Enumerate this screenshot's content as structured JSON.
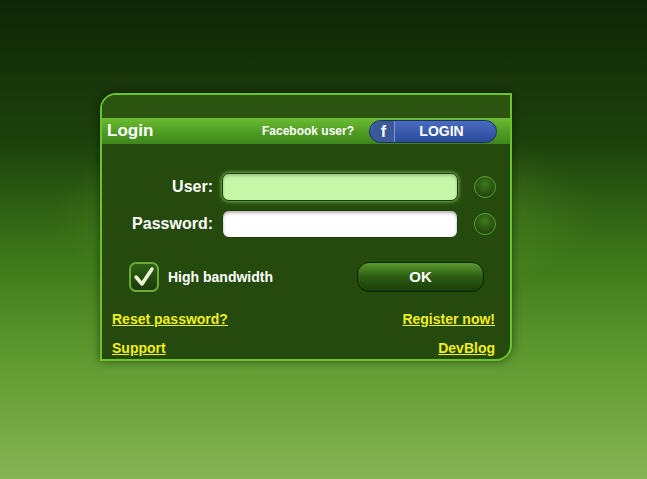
{
  "login": {
    "title": "Login",
    "facebook_prompt": "Facebook user?",
    "facebook_button": {
      "icon": "f",
      "label": "LOGIN"
    }
  },
  "fields": [
    {
      "label": "User:",
      "value": "",
      "focused": true,
      "kind": "text"
    },
    {
      "label": "Password:",
      "value": "",
      "focused": false,
      "kind": "password"
    }
  ],
  "high_bandwidth": {
    "label": "High bandwidth",
    "checked": true
  },
  "buttons": [
    "OK"
  ],
  "links": [
    [
      "Reset password?",
      "Register now!"
    ],
    [
      "Support",
      "DevBlog"
    ]
  ]
}
